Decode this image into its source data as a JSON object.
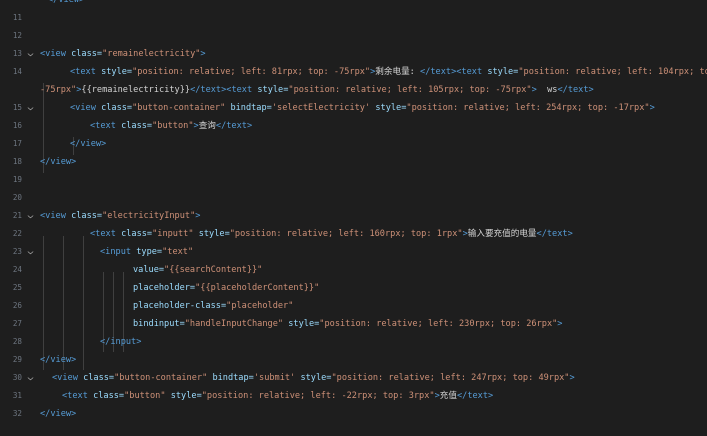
{
  "editor": {
    "language": "wxml",
    "theme_colors": {
      "background": "#1e1e1e",
      "tag": "#569cd6",
      "attribute": "#9cdcfe",
      "string": "#ce9178",
      "text": "#d4d4d4",
      "line_number": "#6e7681"
    }
  },
  "lines": [
    {
      "num": "",
      "fold": false,
      "indent": 48,
      "tokens": [
        {
          "t": "tag",
          "v": "</view>"
        }
      ]
    },
    {
      "num": "11",
      "fold": false,
      "indent": 0,
      "tokens": []
    },
    {
      "num": "12",
      "fold": false,
      "indent": 0,
      "tokens": []
    },
    {
      "num": "13",
      "fold": true,
      "indent": 40,
      "tokens": [
        {
          "t": "tag",
          "v": "<view"
        },
        {
          "t": "txt",
          "v": " "
        },
        {
          "t": "attr",
          "v": "class="
        },
        {
          "t": "str",
          "v": "\"remainelectricity\""
        },
        {
          "t": "tag",
          "v": ">"
        }
      ]
    },
    {
      "num": "14",
      "fold": false,
      "indent": 70,
      "tokens": [
        {
          "t": "tag",
          "v": "<text"
        },
        {
          "t": "txt",
          "v": " "
        },
        {
          "t": "attr",
          "v": "style="
        },
        {
          "t": "str",
          "v": "\"position: relative; left: 81rpx; top: -75rpx\""
        },
        {
          "t": "tag",
          "v": ">"
        },
        {
          "t": "txt",
          "v": "剩余电量: "
        },
        {
          "t": "tag",
          "v": "</text><text"
        },
        {
          "t": "txt",
          "v": " "
        },
        {
          "t": "attr",
          "v": "style="
        },
        {
          "t": "str",
          "v": "\"position: relative; left: 104rpx; top:"
        }
      ]
    },
    {
      "num": "",
      "fold": false,
      "indent": 40,
      "tokens": [
        {
          "t": "str",
          "v": "-75rpx\""
        },
        {
          "t": "tag",
          "v": ">"
        },
        {
          "t": "txt",
          "v": "{{remainelectricity}}"
        },
        {
          "t": "tag",
          "v": "</text><text"
        },
        {
          "t": "txt",
          "v": " "
        },
        {
          "t": "attr",
          "v": "style="
        },
        {
          "t": "str",
          "v": "\"position: relative; left: 105rpx; top: -75rpx\""
        },
        {
          "t": "tag",
          "v": ">"
        },
        {
          "t": "txt",
          "v": "  ws"
        },
        {
          "t": "tag",
          "v": "</text>"
        }
      ]
    },
    {
      "num": "15",
      "fold": true,
      "indent": 70,
      "tokens": [
        {
          "t": "tag",
          "v": "<view"
        },
        {
          "t": "txt",
          "v": " "
        },
        {
          "t": "attr",
          "v": "class="
        },
        {
          "t": "str",
          "v": "\"button-container\""
        },
        {
          "t": "txt",
          "v": " "
        },
        {
          "t": "attr",
          "v": "bindtap="
        },
        {
          "t": "str",
          "v": "'selectElectricity'"
        },
        {
          "t": "txt",
          "v": " "
        },
        {
          "t": "attr",
          "v": "style="
        },
        {
          "t": "str",
          "v": "\"position: relative; left: 254rpx; top: -17rpx\""
        },
        {
          "t": "tag",
          "v": ">"
        }
      ]
    },
    {
      "num": "16",
      "fold": false,
      "indent": 90,
      "tokens": [
        {
          "t": "tag",
          "v": "<text"
        },
        {
          "t": "txt",
          "v": " "
        },
        {
          "t": "attr",
          "v": "class="
        },
        {
          "t": "str",
          "v": "\"button\""
        },
        {
          "t": "tag",
          "v": ">"
        },
        {
          "t": "txt",
          "v": "查询"
        },
        {
          "t": "tag",
          "v": "</text>"
        }
      ]
    },
    {
      "num": "17",
      "fold": false,
      "indent": 70,
      "tokens": [
        {
          "t": "tag",
          "v": "</view>"
        }
      ]
    },
    {
      "num": "18",
      "fold": false,
      "indent": 40,
      "tokens": [
        {
          "t": "tag",
          "v": "</view>"
        }
      ]
    },
    {
      "num": "19",
      "fold": false,
      "indent": 0,
      "tokens": []
    },
    {
      "num": "20",
      "fold": false,
      "indent": 0,
      "tokens": []
    },
    {
      "num": "21",
      "fold": true,
      "indent": 40,
      "tokens": [
        {
          "t": "tag",
          "v": "<view"
        },
        {
          "t": "txt",
          "v": " "
        },
        {
          "t": "attr",
          "v": "class="
        },
        {
          "t": "str",
          "v": "\"electricityInput\""
        },
        {
          "t": "tag",
          "v": ">"
        }
      ]
    },
    {
      "num": "22",
      "fold": false,
      "indent": 90,
      "tokens": [
        {
          "t": "tag",
          "v": "<text"
        },
        {
          "t": "txt",
          "v": " "
        },
        {
          "t": "attr",
          "v": "class="
        },
        {
          "t": "str",
          "v": "\"inputt\""
        },
        {
          "t": "txt",
          "v": " "
        },
        {
          "t": "attr",
          "v": "style="
        },
        {
          "t": "str",
          "v": "\"position: relative; left: 160rpx; top: 1rpx\""
        },
        {
          "t": "tag",
          "v": ">"
        },
        {
          "t": "txt",
          "v": "输入要充值的电量"
        },
        {
          "t": "tag",
          "v": "</text>"
        }
      ]
    },
    {
      "num": "23",
      "fold": true,
      "indent": 100,
      "tokens": [
        {
          "t": "tag",
          "v": "<input"
        },
        {
          "t": "txt",
          "v": " "
        },
        {
          "t": "attr",
          "v": "type="
        },
        {
          "t": "str",
          "v": "\"text\""
        }
      ]
    },
    {
      "num": "24",
      "fold": false,
      "indent": 133,
      "tokens": [
        {
          "t": "attr",
          "v": "value="
        },
        {
          "t": "str",
          "v": "\"{{searchContent}}\""
        }
      ]
    },
    {
      "num": "25",
      "fold": false,
      "indent": 133,
      "tokens": [
        {
          "t": "attr",
          "v": "placeholder="
        },
        {
          "t": "str",
          "v": "\"{{placeholderContent}}\""
        }
      ]
    },
    {
      "num": "26",
      "fold": false,
      "indent": 133,
      "tokens": [
        {
          "t": "attr",
          "v": "placeholder-class="
        },
        {
          "t": "str",
          "v": "\"placeholder\""
        }
      ]
    },
    {
      "num": "27",
      "fold": false,
      "indent": 133,
      "tokens": [
        {
          "t": "attr",
          "v": "bindinput="
        },
        {
          "t": "str",
          "v": "\"handleInputChange\""
        },
        {
          "t": "txt",
          "v": " "
        },
        {
          "t": "attr",
          "v": "style="
        },
        {
          "t": "str",
          "v": "\"position: relative; left: 230rpx; top: 26rpx\""
        },
        {
          "t": "tag",
          "v": ">"
        }
      ]
    },
    {
      "num": "28",
      "fold": false,
      "indent": 100,
      "tokens": [
        {
          "t": "tag",
          "v": "</input>"
        }
      ]
    },
    {
      "num": "29",
      "fold": false,
      "indent": 40,
      "tokens": [
        {
          "t": "tag",
          "v": "</view>"
        }
      ]
    },
    {
      "num": "30",
      "fold": true,
      "indent": 52,
      "tokens": [
        {
          "t": "tag",
          "v": "<view"
        },
        {
          "t": "txt",
          "v": " "
        },
        {
          "t": "attr",
          "v": "class="
        },
        {
          "t": "str",
          "v": "\"button-container\""
        },
        {
          "t": "txt",
          "v": " "
        },
        {
          "t": "attr",
          "v": "bindtap="
        },
        {
          "t": "str",
          "v": "'submit'"
        },
        {
          "t": "txt",
          "v": " "
        },
        {
          "t": "attr",
          "v": "style="
        },
        {
          "t": "str",
          "v": "\"position: relative; left: 247rpx; top: 49rpx\""
        },
        {
          "t": "tag",
          "v": ">"
        }
      ]
    },
    {
      "num": "31",
      "fold": false,
      "indent": 62,
      "tokens": [
        {
          "t": "tag",
          "v": "<text"
        },
        {
          "t": "txt",
          "v": " "
        },
        {
          "t": "attr",
          "v": "class="
        },
        {
          "t": "str",
          "v": "\"button\""
        },
        {
          "t": "txt",
          "v": " "
        },
        {
          "t": "attr",
          "v": "style="
        },
        {
          "t": "str",
          "v": "\"position: relative; left: -22rpx; top: 3rpx\""
        },
        {
          "t": "tag",
          "v": ">"
        },
        {
          "t": "txt",
          "v": "充值"
        },
        {
          "t": "tag",
          "v": "</text>"
        }
      ]
    },
    {
      "num": "32",
      "fold": false,
      "indent": 40,
      "tokens": [
        {
          "t": "tag",
          "v": "</view>"
        }
      ]
    }
  ]
}
